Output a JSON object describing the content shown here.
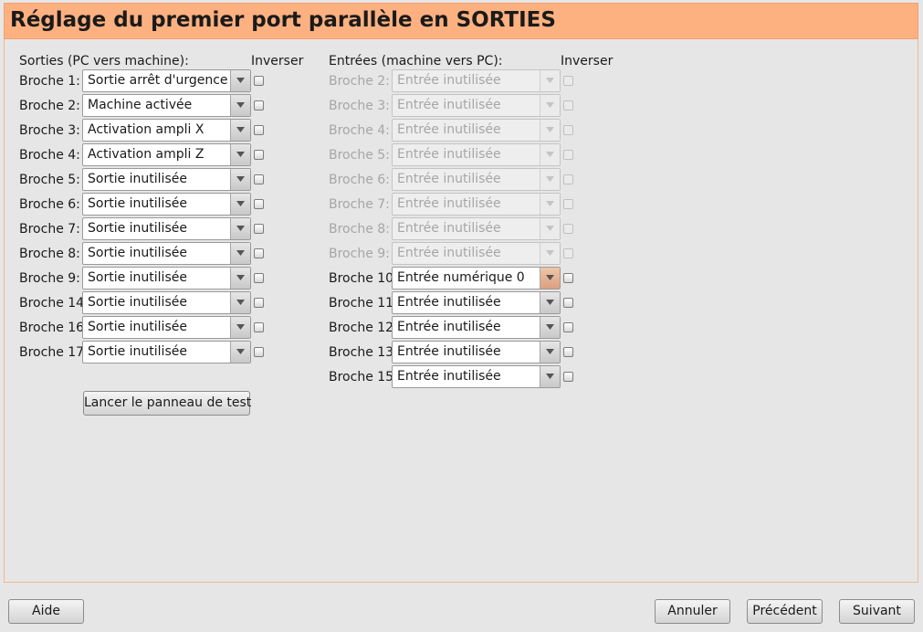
{
  "window": {
    "title": "Réglage du premier port parallèle en SORTIES"
  },
  "outputs": {
    "header": "Sorties (PC vers machine):",
    "invert_header": "Inverser",
    "rows": [
      {
        "label": "Broche 1:",
        "value": "Sortie arrêt d'urgence"
      },
      {
        "label": "Broche 2:",
        "value": "Machine activée"
      },
      {
        "label": "Broche 3:",
        "value": "Activation ampli X"
      },
      {
        "label": "Broche 4:",
        "value": "Activation ampli Z"
      },
      {
        "label": "Broche 5:",
        "value": "Sortie inutilisée"
      },
      {
        "label": "Broche 6:",
        "value": "Sortie inutilisée"
      },
      {
        "label": "Broche 7:",
        "value": "Sortie inutilisée"
      },
      {
        "label": "Broche 8:",
        "value": "Sortie inutilisée"
      },
      {
        "label": "Broche 9:",
        "value": "Sortie inutilisée"
      },
      {
        "label": "Broche 14:",
        "value": "Sortie inutilisée"
      },
      {
        "label": "Broche 16:",
        "value": "Sortie inutilisée"
      },
      {
        "label": "Broche 17:",
        "value": "Sortie inutilisée"
      }
    ],
    "test_button": "Lancer le panneau de test"
  },
  "inputs": {
    "header": "Entrées (machine vers PC):",
    "invert_header": "Inverser",
    "rows": [
      {
        "label": "Broche 2:",
        "value": "Entrée inutilisée",
        "enabled": false
      },
      {
        "label": "Broche 3:",
        "value": "Entrée inutilisée",
        "enabled": false
      },
      {
        "label": "Broche 4:",
        "value": "Entrée inutilisée",
        "enabled": false
      },
      {
        "label": "Broche 5:",
        "value": "Entrée inutilisée",
        "enabled": false
      },
      {
        "label": "Broche 6:",
        "value": "Entrée inutilisée",
        "enabled": false
      },
      {
        "label": "Broche 7:",
        "value": "Entrée inutilisée",
        "enabled": false
      },
      {
        "label": "Broche 8:",
        "value": "Entrée inutilisée",
        "enabled": false
      },
      {
        "label": "Broche 9:",
        "value": "Entrée inutilisée",
        "enabled": false
      },
      {
        "label": "Broche 10:",
        "value": "Entrée numérique 0",
        "enabled": true
      },
      {
        "label": "Broche 11:",
        "value": "Entrée inutilisée",
        "enabled": true
      },
      {
        "label": "Broche 12:",
        "value": "Entrée inutilisée",
        "enabled": true
      },
      {
        "label": "Broche 13:",
        "value": "Entrée inutilisée",
        "enabled": true
      },
      {
        "label": "Broche 15:",
        "value": "Entrée inutilisée",
        "enabled": true
      }
    ]
  },
  "footer": {
    "help": "Aide",
    "cancel": "Annuler",
    "previous": "Précédent",
    "next": "Suivant"
  },
  "colors": {
    "title_bar": "#fdb180",
    "window_bg": "#e6e6e6",
    "disabled_text": "#a6a6a6"
  }
}
